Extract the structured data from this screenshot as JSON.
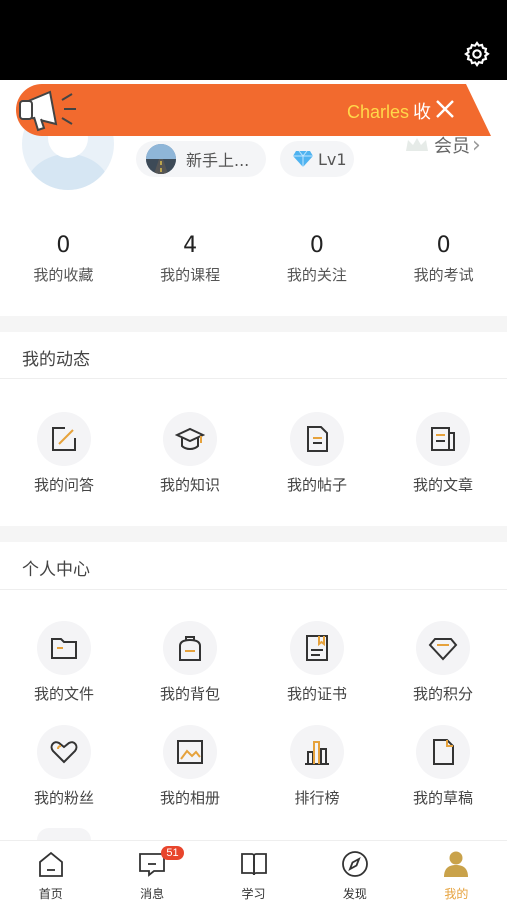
{
  "banner": {
    "name": "Charles",
    "collapse_label": "收"
  },
  "profile": {
    "newbie_label": "新手上...",
    "level_label": "Lv1",
    "vip_label": "会员",
    "vip_chevron": "›"
  },
  "stats": [
    {
      "value": "0",
      "label": "我的收藏"
    },
    {
      "value": "4",
      "label": "我的课程"
    },
    {
      "value": "0",
      "label": "我的关注"
    },
    {
      "value": "0",
      "label": "我的考试"
    }
  ],
  "activity": {
    "title": "我的动态",
    "items": [
      {
        "label": "我的问答",
        "icon": "edit-icon"
      },
      {
        "label": "我的知识",
        "icon": "graduation-cap-icon"
      },
      {
        "label": "我的帖子",
        "icon": "document-icon"
      },
      {
        "label": "我的文章",
        "icon": "article-icon"
      }
    ]
  },
  "center": {
    "title": "个人中心",
    "items": [
      {
        "label": "我的文件",
        "icon": "folder-icon"
      },
      {
        "label": "我的背包",
        "icon": "backpack-icon"
      },
      {
        "label": "我的证书",
        "icon": "certificate-icon"
      },
      {
        "label": "我的积分",
        "icon": "diamond-icon"
      },
      {
        "label": "我的粉丝",
        "icon": "heart-icon"
      },
      {
        "label": "我的相册",
        "icon": "image-icon"
      },
      {
        "label": "排行榜",
        "icon": "bar-chart-icon"
      },
      {
        "label": "我的草稿",
        "icon": "draft-icon"
      }
    ]
  },
  "tabs": [
    {
      "label": "首页",
      "icon": "home-icon"
    },
    {
      "label": "消息",
      "icon": "message-icon",
      "badge": "51"
    },
    {
      "label": "学习",
      "icon": "book-icon"
    },
    {
      "label": "发现",
      "icon": "compass-icon"
    },
    {
      "label": "我的",
      "icon": "user-icon",
      "active": true
    }
  ],
  "colors": {
    "accent": "#e6a23c",
    "banner": "#f26a2e",
    "badge": "#e8452c"
  }
}
